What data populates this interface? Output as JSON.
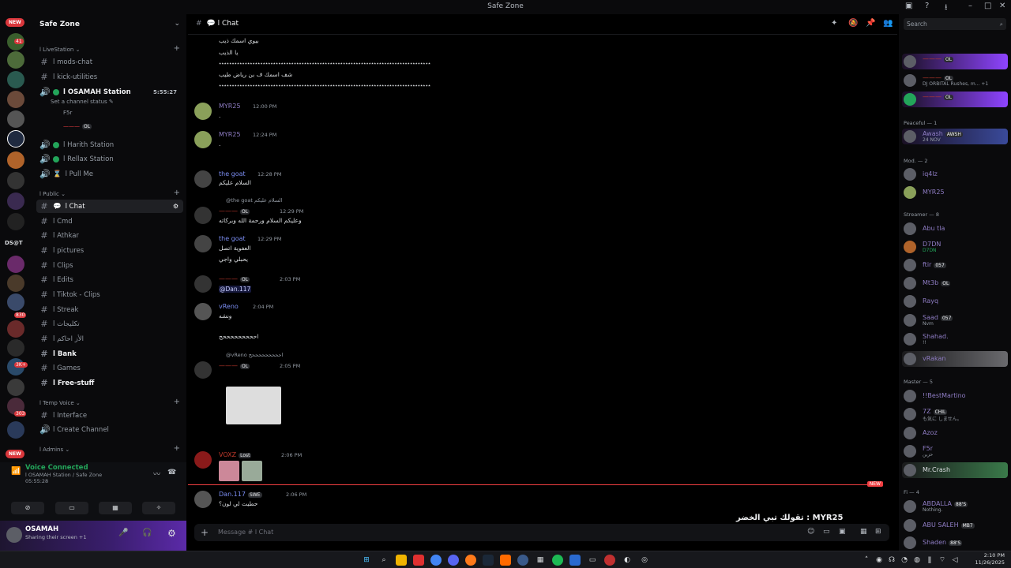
{
  "window": {
    "title": "Safe Zone"
  },
  "rail": {
    "new_top": "NEW",
    "new_bottom": "NEW",
    "badges": [
      "41",
      "830",
      "3K+",
      "303"
    ],
    "dsat": "DS@T"
  },
  "server": {
    "name": "Safe Zone"
  },
  "sidebar": {
    "cat_livestation": "l LiveStation ⌄",
    "mods_chat": "l mods-chat",
    "kick_utilities": "l kick-utilities",
    "osamah_station": "l OSAMAH Station",
    "osamah_timer": "5:55:27",
    "set_status": "Set a channel status ✎",
    "voice_user1": "F5r",
    "voice_user2_tag": "OL",
    "harith_station": "l Harith Station",
    "rellax_station": "l Rellax Station",
    "pull_me": "l Pull Me",
    "cat_public": "l Public ⌄",
    "chat": "l Chat",
    "cmd": "l Cmd",
    "athkar": "l Athkar",
    "pictures": "l pictures",
    "clips": "l Clips",
    "edits": "l Edits",
    "tiktok_clips": "l Tiktok - Clips",
    "streak": "l Streak",
    "takleefat": "l تكليجات",
    "alzikr": "l الأز احاكم",
    "bank": "l Bank",
    "games": "l Games",
    "free_stuff": "l Free-stuff",
    "cat_temp_voice": "l Temp Voice ⌄",
    "interface": "l Interface",
    "create_channel": "l Create Channel",
    "cat_admins": "l Admins ⌄"
  },
  "voice_panel": {
    "title": "Voice Connected",
    "subtitle": "l OSAMAH Station / Safe Zone",
    "time": "05:55:28"
  },
  "user_panel": {
    "name": "OSAMAH",
    "status": "Sharing their screen +1"
  },
  "chat": {
    "channel_name": "l Chat",
    "messages": [
      {
        "lines": [
          "بيوي اسمك ذيب",
          "يا الذيب",
          "شف اسمك ف بن رياض طيب"
        ],
        "deco": "٭٭٭٭٭٭٭٭٭٭٭٭٭٭٭٭٭٭٭٭٭٭٭٭٭٭٭٭٭٭٭٭٭٭٭٭٭٭٭٭٭٭٭٭٭٭٭٭٭٭٭٭٭٭٭٭٭٭٭٭٭٭٭٭٭٭٭٭٭٭٭٭٭٭٭٭٭٭٭٭٭٭"
      },
      {
        "author": "MYR25",
        "time": "12:00 PM",
        "text": "."
      },
      {
        "author": "MYR25",
        "time": "12:24 PM",
        "text": "."
      },
      {
        "author": "the goat",
        "time": "12:28 PM",
        "text": "السلام عليكم"
      },
      {
        "reply": "@the goat السلام عليكم",
        "author_tag": "OL",
        "time": "12:29 PM",
        "text": "وعليكم السلام ورحمة الله وبركاته"
      },
      {
        "author": "the goat",
        "time": "12:29 PM",
        "text": "العفوية اتصل",
        "text2": "يحبلي واجي"
      },
      {
        "author_tag": "OL",
        "time": "2:03 PM",
        "text": "@Dan.117"
      },
      {
        "author": "vReno",
        "time": "2:04 PM",
        "text": "ونشه",
        "text2": "احححححححححح"
      },
      {
        "reply": "@vReno احححححححححح",
        "author_tag": "OL",
        "time": "2:05 PM"
      },
      {
        "author": "VOXZ",
        "author_tag": "Lost",
        "time": "2:06 PM"
      },
      {
        "author": "Dan.117",
        "author_tag": "SWE",
        "time": "2:06 PM",
        "text": "حطيت لي لون؟"
      }
    ],
    "new_label": "NEW"
  },
  "composer": {
    "placeholder": "Message # l Chat",
    "overlay": "تقولك تبي الخضر : MYR25"
  },
  "members": {
    "search_placeholder": "Search",
    "top": [
      {
        "name": "",
        "tag": "OL"
      },
      {
        "name": "DJ ORBITAL",
        "sub": "DJ ORBITAL Rushes, m... +1",
        "tag": "OL"
      },
      {
        "name": "",
        "tag": "OL"
      }
    ],
    "cat_peaceful": "Peaceful — 1",
    "peaceful": [
      {
        "name": "Awash",
        "sub": "24 NOV",
        "tag": "AWSH"
      }
    ],
    "cat_mod": "Mod. — 2",
    "mod": [
      {
        "name": "iq4lz"
      },
      {
        "name": "MYR25"
      }
    ],
    "cat_streamer": "Streamer — 8",
    "streamer": [
      {
        "name": "Abu tla"
      },
      {
        "name": "D7DN",
        "sub": "D7DN"
      },
      {
        "name": "ftir",
        "tag": "057"
      },
      {
        "name": "Mt3b",
        "tag": "OL"
      },
      {
        "name": "Rayq"
      },
      {
        "name": "Saad",
        "sub": "Nvm",
        "tag": "057"
      },
      {
        "name": "Shahad.",
        "sub": "!!"
      },
      {
        "name": "vRakan"
      }
    ],
    "cat_master": "Master — 5",
    "master": [
      {
        "name": "!!BestMartino"
      },
      {
        "name": "7Z",
        "sub": "も気に しません。",
        "tag": "CHIL"
      },
      {
        "name": "Azoz"
      },
      {
        "name": "F5r",
        "sub": "حزين"
      },
      {
        "name": "Mr.Crash"
      }
    ],
    "cat_fi": "Fi — 4",
    "fi": [
      {
        "name": "ABDALLA",
        "sub": "Nothing.",
        "tag": "88'S"
      },
      {
        "name": "ABU SALEH",
        "tag": "MB7"
      },
      {
        "name": "Shaden",
        "tag": "88'S"
      }
    ]
  },
  "taskbar": {
    "time": "2:10 PM",
    "date": "11/26/2025"
  },
  "colors": {
    "accent": "#5865f2",
    "online": "#23a55a",
    "danger": "#f23f42",
    "member_purple": "#8e44ff",
    "author_myr": "#8e7cc3",
    "author_goat": "#7a8cf0",
    "author_red": "#c0392b"
  }
}
